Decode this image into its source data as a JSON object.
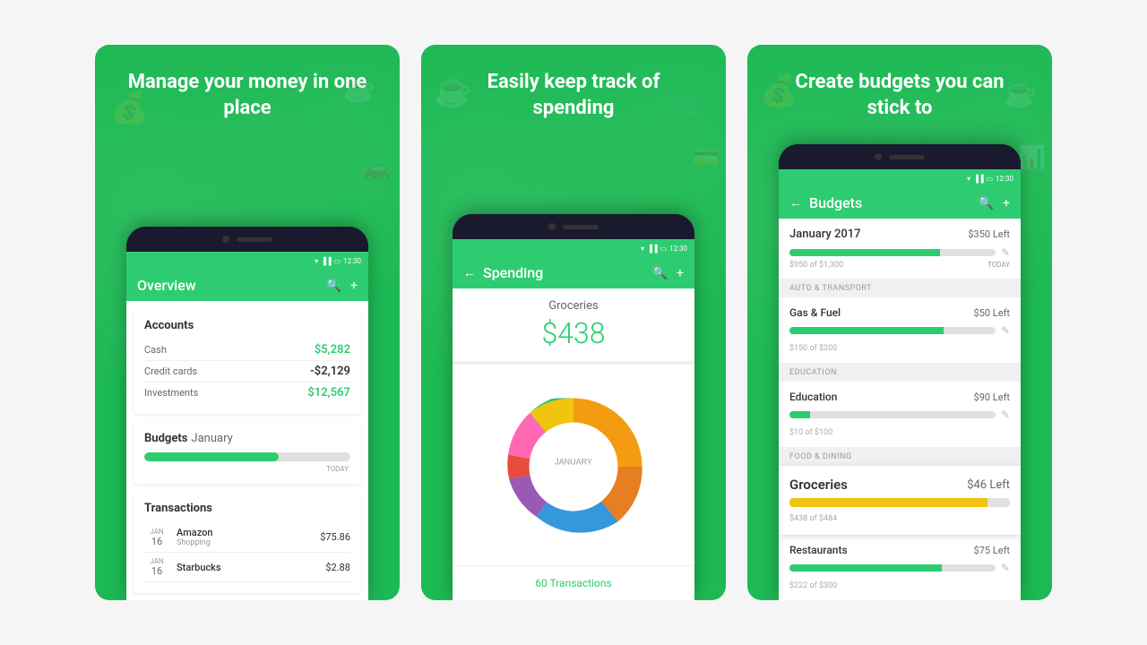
{
  "screen1": {
    "title": "Manage your money\nin one place",
    "appTitle": "Overview",
    "statusTime": "12:30",
    "accounts": {
      "label": "Accounts",
      "items": [
        {
          "name": "Cash",
          "value": "$5,282",
          "type": "positive"
        },
        {
          "name": "Credit cards",
          "value": "-$2,129",
          "type": "negative"
        },
        {
          "name": "Investments",
          "value": "$12,567",
          "type": "positive"
        }
      ]
    },
    "budgets": {
      "label": "Budgets",
      "month": "January",
      "progress": 65,
      "todayLabel": "TODAY"
    },
    "transactions": {
      "label": "Transactions",
      "items": [
        {
          "month": "JAN",
          "day": "16",
          "name": "Amazon",
          "category": "Shopping",
          "amount": "$75.86"
        },
        {
          "month": "JAN",
          "day": "16",
          "name": "Starbucks",
          "category": "",
          "amount": "$2.88"
        }
      ]
    }
  },
  "screen2": {
    "title": "Easily keep track\nof spending",
    "appTitle": "Spending",
    "statusTime": "12:30",
    "categoryName": "Groceries",
    "amount": "$438",
    "centerLabel": "JANUARY",
    "transactionsLink": "60 Transactions",
    "chartSegments": [
      {
        "color": "#f39c12",
        "percent": 28
      },
      {
        "color": "#e67e22",
        "percent": 15
      },
      {
        "color": "#3498db",
        "percent": 18
      },
      {
        "color": "#9b59b6",
        "percent": 8
      },
      {
        "color": "#e74c3c",
        "percent": 6
      },
      {
        "color": "#ff69b4",
        "percent": 8
      },
      {
        "color": "#2ecc71",
        "percent": 5
      },
      {
        "color": "#1abc9c",
        "percent": 4
      },
      {
        "color": "#27ae60",
        "percent": 4
      },
      {
        "color": "#f1c40f",
        "percent": 4
      }
    ]
  },
  "screen3": {
    "title": "Create budgets\nyou can stick to",
    "appTitle": "Budgets",
    "statusTime": "12:30",
    "budgetMonth": "January 2017",
    "budgetLeftAmount": "$350 Left",
    "budgetOf": "$950 of $1,300",
    "todayLabel": "TODAY",
    "sections": [
      {
        "label": "AUTO & TRANSPORT",
        "items": [
          {
            "name": "Gas & Fuel",
            "left": "$50 Left",
            "of": "$150 of $200",
            "progress": 75,
            "type": "green"
          }
        ]
      },
      {
        "label": "EDUCATION",
        "items": [
          {
            "name": "Education",
            "left": "$90 Left",
            "of": "$10 of $100",
            "progress": 10,
            "type": "green"
          }
        ]
      },
      {
        "label": "FOOD & DINING",
        "items": [
          {
            "name": "Groceries",
            "left": "$46 Left",
            "of": "$438 of $484",
            "progress": 90,
            "type": "yellow"
          },
          {
            "name": "Restaurants",
            "left": "$75 Left",
            "of": "$222 of $300",
            "progress": 74,
            "type": "green"
          }
        ]
      }
    ]
  }
}
